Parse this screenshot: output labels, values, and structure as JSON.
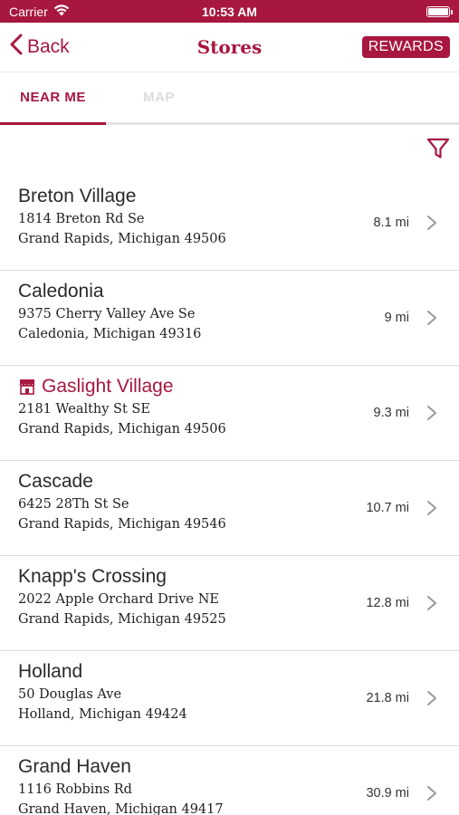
{
  "status_bar": {
    "carrier": "Carrier",
    "time": "10:53 AM"
  },
  "nav": {
    "back_label": "Back",
    "title": "Stores",
    "rewards_label": "REWARDS"
  },
  "tabs": [
    {
      "label": "NEAR ME",
      "active": true
    },
    {
      "label": "MAP",
      "active": false
    }
  ],
  "colors": {
    "accent": "#a8173f"
  },
  "stores": [
    {
      "name": "Breton Village",
      "address1": "1814 Breton Rd Se",
      "address2": "Grand Rapids, Michigan 49506",
      "distance": "8.1 mi"
    },
    {
      "name": "Caledonia",
      "address1": "9375 Cherry Valley Ave Se",
      "address2": "Caledonia, Michigan 49316",
      "distance": "9 mi"
    },
    {
      "name": "Gaslight Village",
      "address1": "2181 Wealthy St SE",
      "address2": "Grand Rapids, Michigan 49506",
      "distance": "9.3 mi",
      "home_store": true,
      "icon": "storefront-icon"
    },
    {
      "name": "Cascade",
      "address1": "6425 28Th St Se",
      "address2": "Grand Rapids, Michigan 49546",
      "distance": "10.7 mi"
    },
    {
      "name": "Knapp's Crossing",
      "address1": "2022 Apple Orchard Drive NE",
      "address2": "Grand Rapids, Michigan 49525",
      "distance": "12.8 mi"
    },
    {
      "name": "Holland",
      "address1": "50 Douglas Ave",
      "address2": "Holland, Michigan 49424",
      "distance": "21.8 mi"
    },
    {
      "name": "Grand Haven",
      "address1": "1116 Robbins Rd",
      "address2": "Grand Haven, Michigan 49417",
      "distance": "30.9 mi"
    }
  ]
}
